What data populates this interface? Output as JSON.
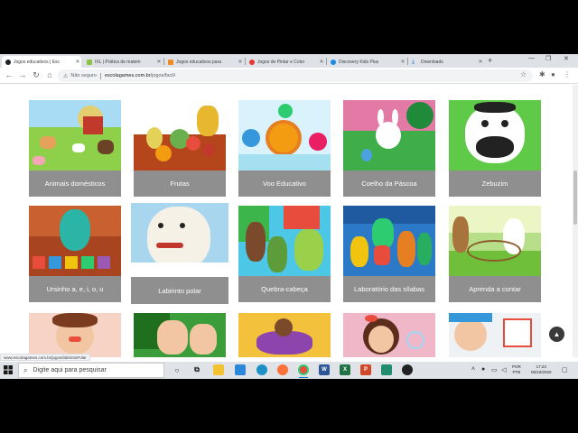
{
  "browser": {
    "tabs": [
      {
        "title": "Jogos educativos | Esc",
        "favicon_color": "#f2b400",
        "active": true
      },
      {
        "title": "IXL | Prática de matem",
        "favicon_color": "#4caf50",
        "active": false
      },
      {
        "title": "Jogos educativos para",
        "favicon_color": "#f08a24",
        "active": false
      },
      {
        "title": "Jogos de Pintar e Color",
        "favicon_color": "#e53935",
        "active": false
      },
      {
        "title": "Discovery Kids Plus",
        "favicon_color": "#1e88e5",
        "active": false
      },
      {
        "title": "Downloads",
        "favicon_color": "#1a73e8",
        "active": false
      }
    ],
    "new_tab": "+",
    "address": {
      "security_label": "Não seguro",
      "domain": "escolagames.com.br",
      "path": "/jogos/facil/"
    }
  },
  "games": [
    {
      "label": "Animais domésticos",
      "theme": "farm"
    },
    {
      "label": "Frutas",
      "theme": "fruits"
    },
    {
      "label": "Voo Educativo",
      "theme": "flight"
    },
    {
      "label": "Coelho da Páscoa",
      "theme": "bunny"
    },
    {
      "label": "Zebuzim",
      "theme": "cow"
    },
    {
      "label": "Ursinho a, e, i, o, u",
      "theme": "bear"
    },
    {
      "label": "Labirinto polar",
      "theme": "polar"
    },
    {
      "label": "Quebra-cabeça",
      "theme": "puzzle"
    },
    {
      "label": "Laboratório das sílabas",
      "theme": "lab"
    },
    {
      "label": "Aprenda a contar",
      "theme": "count"
    },
    {
      "label": "",
      "theme": "girl"
    },
    {
      "label": "",
      "theme": "hands"
    },
    {
      "label": "",
      "theme": "plane"
    },
    {
      "label": "",
      "theme": "bubble"
    },
    {
      "label": "",
      "theme": "clown"
    }
  ],
  "status_url": "www.escolagames.com.br/jogos/labirintoPolar",
  "taskbar": {
    "search_placeholder": "Digite aqui para pesquisar",
    "language_top": "POR",
    "language_bottom": "PTB",
    "time": "17:23",
    "date": "05/10/2020"
  }
}
